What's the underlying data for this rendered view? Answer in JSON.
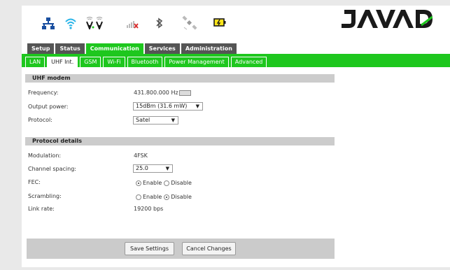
{
  "brand": {
    "logo_text": "JAVAD"
  },
  "status_icons": [
    "network-icon",
    "wifi-icon",
    "gsm-signal-icon",
    "cellular-signal-icon",
    "bluetooth-icon",
    "satellite-icon",
    "battery-icon"
  ],
  "main_tabs": [
    {
      "label": "Setup",
      "active": false
    },
    {
      "label": "Status",
      "active": false
    },
    {
      "label": "Communication",
      "active": true
    },
    {
      "label": "Services",
      "active": false
    },
    {
      "label": "Administration",
      "active": false
    }
  ],
  "sub_tabs": [
    {
      "label": "LAN",
      "active": false
    },
    {
      "label": "UHF Int.",
      "active": true
    },
    {
      "label": "GSM",
      "active": false
    },
    {
      "label": "Wi-Fi",
      "active": false
    },
    {
      "label": "Bluetooth",
      "active": false
    },
    {
      "label": "Power Management",
      "active": false
    },
    {
      "label": "Advanced",
      "active": false
    }
  ],
  "uhf_modem": {
    "title": "UHF modem",
    "frequency": {
      "label": "Frequency:",
      "value": "431.800.000 Hz"
    },
    "output_power": {
      "label": "Output power:",
      "value": "15dBm (31.6 mW)"
    },
    "protocol": {
      "label": "Protocol:",
      "value": "Satel"
    }
  },
  "protocol_details": {
    "title": "Protocol details",
    "modulation": {
      "label": "Modulation:",
      "value": "4FSK"
    },
    "channel_spacing": {
      "label": "Channel spacing:",
      "value": "25.0"
    },
    "fec": {
      "label": "FEC:",
      "enable": "Enable",
      "disable": "Disable",
      "selected": "Enable"
    },
    "scrambling": {
      "label": "Scrambling:",
      "enable": "Enable",
      "disable": "Disable",
      "selected": "Disable"
    },
    "link_rate": {
      "label": "Link rate:",
      "value": "19200 bps"
    }
  },
  "buttons": {
    "save": "Save Settings",
    "cancel": "Cancel Changes"
  },
  "colors": {
    "accent": "#1ec71e",
    "tab_dark": "#555555",
    "brand": "#1a1a1a"
  }
}
